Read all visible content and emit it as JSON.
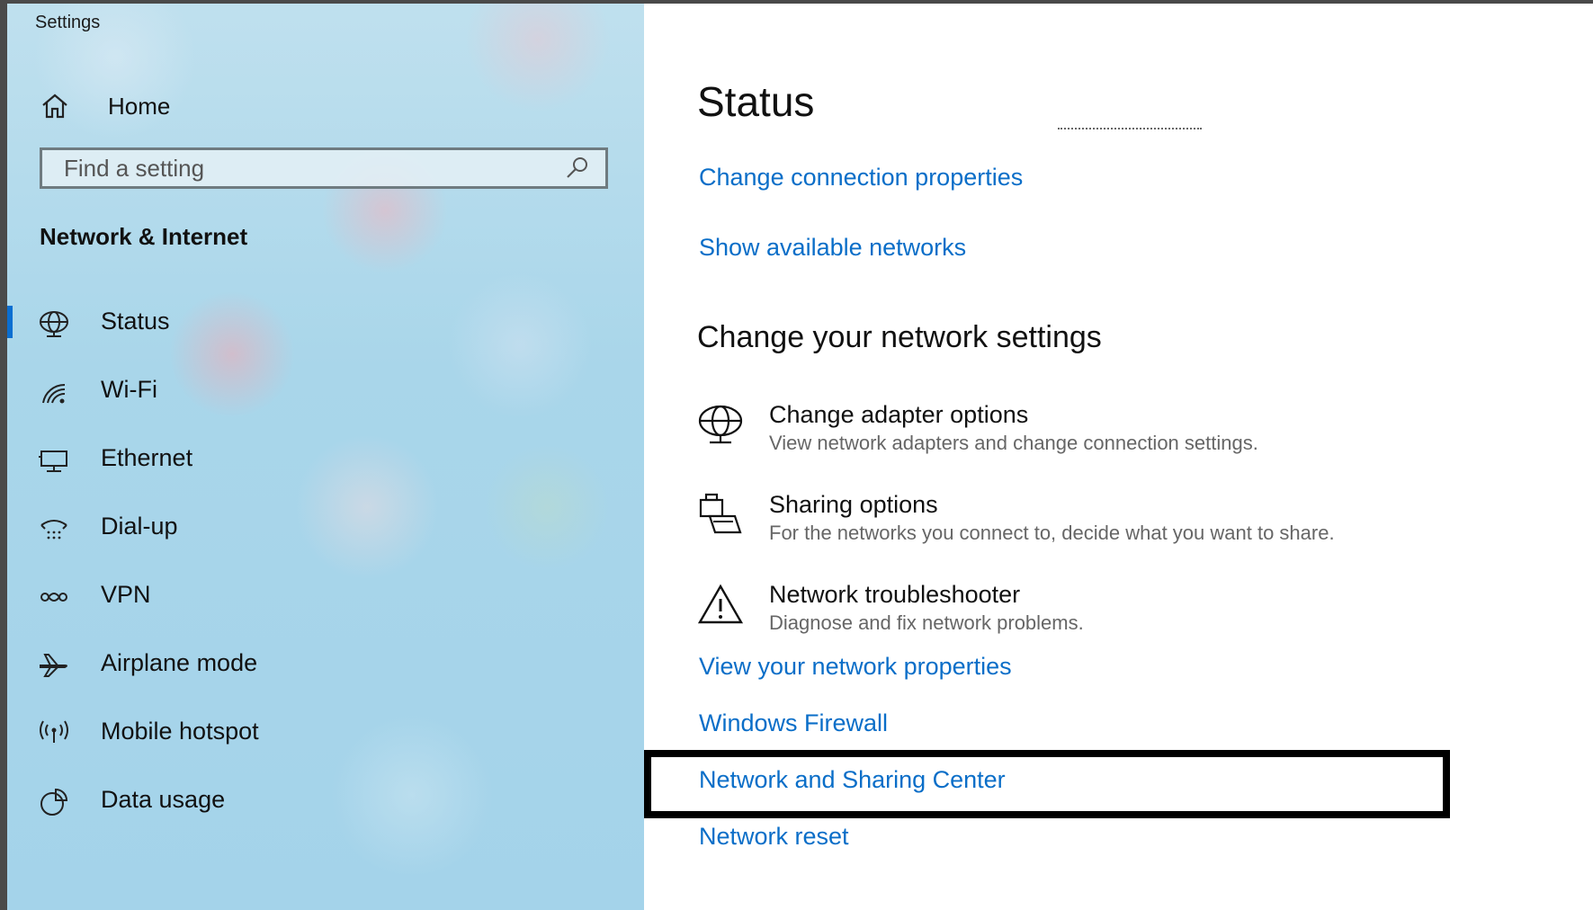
{
  "window": {
    "title": "Settings"
  },
  "sidebar": {
    "home_label": "Home",
    "search_placeholder": "Find a setting",
    "section_title": "Network & Internet",
    "items": [
      {
        "label": "Status",
        "icon": "globe-icon",
        "selected": true
      },
      {
        "label": "Wi-Fi",
        "icon": "wifi-icon",
        "selected": false
      },
      {
        "label": "Ethernet",
        "icon": "ethernet-icon",
        "selected": false
      },
      {
        "label": "Dial-up",
        "icon": "dial-up-icon",
        "selected": false
      },
      {
        "label": "VPN",
        "icon": "vpn-icon",
        "selected": false
      },
      {
        "label": "Airplane mode",
        "icon": "airplane-icon",
        "selected": false
      },
      {
        "label": "Mobile hotspot",
        "icon": "hotspot-icon",
        "selected": false
      },
      {
        "label": "Data usage",
        "icon": "data-usage-icon",
        "selected": false
      }
    ]
  },
  "main": {
    "title": "Status",
    "links_top": [
      {
        "label": "Change connection properties"
      },
      {
        "label": "Show available networks"
      }
    ],
    "change_section_title": "Change your network settings",
    "options": [
      {
        "title": "Change adapter options",
        "description": "View network adapters and change connection settings.",
        "icon": "globe-adapter-icon"
      },
      {
        "title": "Sharing options",
        "description": "For the networks you connect to, decide what you want to share.",
        "icon": "sharing-icon"
      },
      {
        "title": "Network troubleshooter",
        "description": "Diagnose and fix network problems.",
        "icon": "warning-icon"
      }
    ],
    "links_bottom": [
      {
        "label": "View your network properties"
      },
      {
        "label": "Windows Firewall"
      },
      {
        "label": "Network and Sharing Center",
        "highlighted": true
      },
      {
        "label": "Network reset"
      }
    ]
  },
  "colors": {
    "accent": "#0a6ec8",
    "selection_indicator": "#0a6ed1",
    "highlight_border": "#000000"
  }
}
